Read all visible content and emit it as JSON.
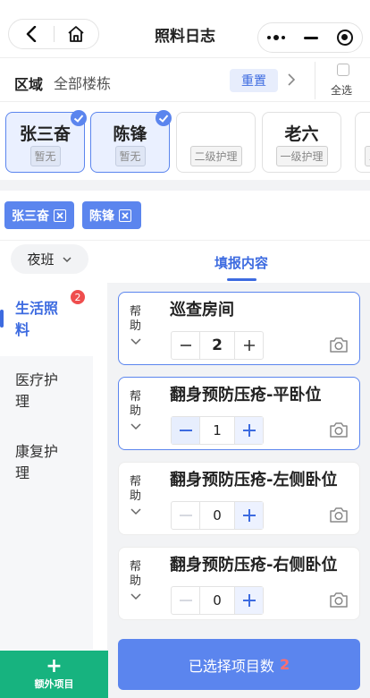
{
  "nav": {
    "title": "照料日志",
    "icons": [
      "back-arrow-icon",
      "home-icon",
      "more-dots-icon",
      "minimize-icon",
      "record-target-icon"
    ]
  },
  "area": {
    "label": "区域",
    "value": "全部楼栋",
    "reset_label": "重置",
    "select_all_label": "全选"
  },
  "patients": [
    {
      "name": "张三奋",
      "level": "暂无",
      "selected": true
    },
    {
      "name": "陈锋",
      "level": "暂无",
      "selected": true
    },
    {
      "name": "",
      "level": "二级护理",
      "selected": false
    },
    {
      "name": "老六",
      "level": "一级护理",
      "selected": false
    },
    {
      "name": "",
      "level": "二",
      "selected": false
    }
  ],
  "chips": [
    "张三奋",
    "陈锋"
  ],
  "shift": {
    "value": "夜班"
  },
  "tab": {
    "label": "填报内容"
  },
  "sidebar": {
    "items": [
      {
        "label": "生活照料",
        "line1": "生活照",
        "line2": "料",
        "active": true,
        "badge": "2"
      },
      {
        "label": "医疗护理",
        "line1": "医疗护",
        "line2": "理",
        "active": false
      },
      {
        "label": "康复护理",
        "line1": "康复护",
        "line2": "理",
        "active": false
      }
    ]
  },
  "items": [
    {
      "help": "帮助",
      "help1": "帮",
      "help2": "助",
      "name": "巡查房间",
      "value": "2",
      "selected": true
    },
    {
      "help": "帮助",
      "help1": "帮",
      "help2": "助",
      "name": "翻身预防压疮-平卧位",
      "value": "1",
      "selected": true
    },
    {
      "help": "帮助",
      "help1": "帮",
      "help2": "助",
      "name": "翻身预防压疮-左侧卧位",
      "value": "0",
      "selected": false
    },
    {
      "help": "帮助",
      "help1": "帮",
      "help2": "助",
      "name": "翻身预防压疮-右侧卧位",
      "value": "0",
      "selected": false
    }
  ],
  "bottom": {
    "extra_label": "额外项目",
    "submit_label": "已选择项目数",
    "submit_count": "2"
  },
  "colors": {
    "accent": "#5b85ee",
    "accent_text": "#3d6be0",
    "green": "#17b37f",
    "badge": "#ef4d4d"
  }
}
